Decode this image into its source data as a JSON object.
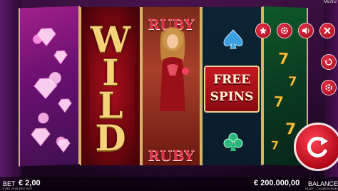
{
  "reels": {
    "reel2_symbol": "WILD",
    "reel3_top": "RUBY",
    "reel3_bottom": "RUBY",
    "reel4_feature_line1": "FREE",
    "reel4_feature_line2": "SPINS"
  },
  "bottom": {
    "bet_label": "BET",
    "bet_value": "€ 2,00",
    "bet_sub": "ЕЛЕГ ЛОЯ ЕЕР  ЕЕР",
    "balance_value": "€ 200.000,00",
    "balance_label": "BALANCE",
    "balance_sub": "RUBY · CASINOGRAM"
  },
  "top_menu": "MENU",
  "colors": {
    "accent_red": "#d01828",
    "gold": "#f3d27a",
    "ruby": "#e2324a"
  },
  "icons": [
    "favorite-icon",
    "settings-icon",
    "sound-icon",
    "close-icon",
    "history-icon",
    "autoplay-icon",
    "spin-icon"
  ]
}
